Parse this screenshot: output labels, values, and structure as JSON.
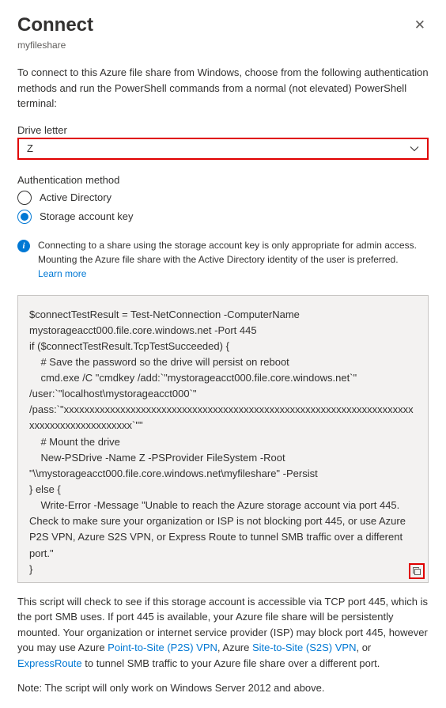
{
  "header": {
    "title": "Connect",
    "subtitle": "myfileshare",
    "close": "✕"
  },
  "intro": "To connect to this Azure file share from Windows, choose from the following authentication methods and run the PowerShell commands from a normal (not elevated) PowerShell terminal:",
  "drive": {
    "label": "Drive letter",
    "value": "Z"
  },
  "auth": {
    "label": "Authentication method",
    "option_ad": "Active Directory",
    "option_key": "Storage account key"
  },
  "info": {
    "text": "Connecting to a share using the storage account key is only appropriate for admin access. Mounting the Azure file share with the Active Directory identity of the user is preferred.",
    "link": "Learn more"
  },
  "code": "$connectTestResult = Test-NetConnection -ComputerName mystorageacct000.file.core.windows.net -Port 445\nif ($connectTestResult.TcpTestSucceeded) {\n    # Save the password so the drive will persist on reboot\n    cmd.exe /C \"cmdkey /add:`\"mystorageacct000.file.core.windows.net`\" /user:`\"localhost\\mystorageacct000`\" /pass:`\"xxxxxxxxxxxxxxxxxxxxxxxxxxxxxxxxxxxxxxxxxxxxxxxxxxxxxxxxxxxxxxxxxxxxxxxxxxxxxxxxxxxxxxxx`\"\"\n    # Mount the drive\n    New-PSDrive -Name Z -PSProvider FileSystem -Root \"\\\\mystorageacct000.file.core.windows.net\\myfileshare\" -Persist\n} else {\n    Write-Error -Message \"Unable to reach the Azure storage account via port 445. Check to make sure your organization or ISP is not blocking port 445, or use Azure P2S VPN, Azure S2S VPN, or Express Route to tunnel SMB traffic over a different port.\"\n}",
  "footer": {
    "pre": "This script will check to see if this storage account is accessible via TCP port 445, which is the port SMB uses. If port 445 is available, your Azure file share will be persistently mounted. Your organization or internet service provider (ISP) may block port 445, however you may use Azure ",
    "l1": "Point-to-Site (P2S) VPN",
    "m1": ", Azure ",
    "l2": "Site-to-Site (S2S) VPN",
    "m2": ", or ",
    "l3": "ExpressRoute",
    "post": " to tunnel SMB traffic to your Azure file share over a different port."
  },
  "note": "Note: The script will only work on Windows Server 2012 and above."
}
